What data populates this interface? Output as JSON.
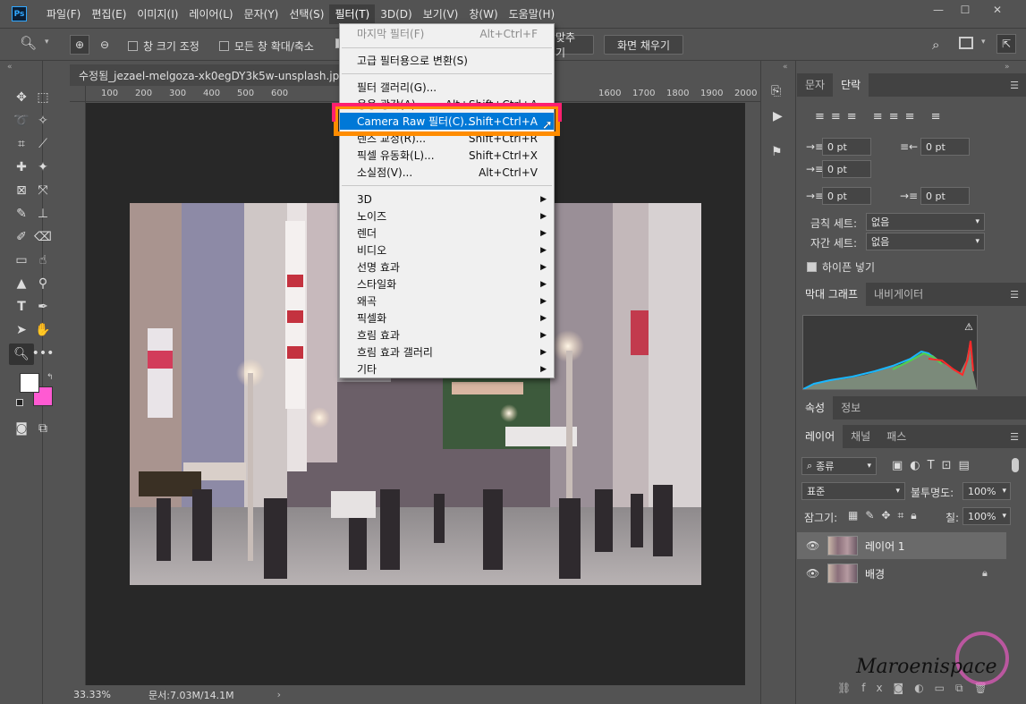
{
  "menubar": {
    "items": [
      "파일(F)",
      "편집(E)",
      "이미지(I)",
      "레이어(L)",
      "문자(Y)",
      "선택(S)",
      "필터(T)",
      "3D(D)",
      "보기(V)",
      "창(W)",
      "도움말(H)"
    ],
    "active": "필터(T)",
    "logo": "Ps"
  },
  "options": {
    "resize_windows": "창 크기 조정",
    "zoom_all_windows": "모든 창 확대/축소",
    "fit_screen_partial": "맞추기",
    "fill_screen": "화면 채우기"
  },
  "document": {
    "tab_title": "수정됨_jezael-melgoza-xk0egDY3k5w-unsplash.jpg @",
    "ruler_ticks": [
      "100",
      "200",
      "300",
      "400",
      "500",
      "600",
      "1600",
      "1700",
      "1800",
      "1900",
      "2000"
    ],
    "zoom": "33.33%",
    "doc_size": "문서:7.03M/14.1M"
  },
  "filter_menu": {
    "items": [
      {
        "label": "마지막 필터(F)",
        "shortcut": "Alt+Ctrl+F",
        "disabled": true
      },
      {
        "label": "고급 필터용으로 변환(S)"
      },
      {
        "label": "필터 갤러리(G)..."
      },
      {
        "label": "응용 광각(A)...",
        "shortcut": "Alt+Shift+Ctrl+A"
      },
      {
        "label": "Camera Raw 필터(C)...",
        "shortcut": "Shift+Ctrl+A",
        "highlighted": true
      },
      {
        "label": "렌즈 교정(R)...",
        "shortcut": "Shift+Ctrl+R"
      },
      {
        "label": "픽셀 유동화(L)...",
        "shortcut": "Shift+Ctrl+X"
      },
      {
        "label": "소실점(V)...",
        "shortcut": "Alt+Ctrl+V"
      },
      {
        "label": "3D",
        "submenu": true
      },
      {
        "label": "노이즈",
        "submenu": true
      },
      {
        "label": "렌더",
        "submenu": true
      },
      {
        "label": "비디오",
        "submenu": true
      },
      {
        "label": "선명 효과",
        "submenu": true
      },
      {
        "label": "스타일화",
        "submenu": true
      },
      {
        "label": "왜곡",
        "submenu": true
      },
      {
        "label": "픽셀화",
        "submenu": true
      },
      {
        "label": "흐림 효과",
        "submenu": true
      },
      {
        "label": "흐림 효과 갤러리",
        "submenu": true
      },
      {
        "label": "기타",
        "submenu": true
      }
    ]
  },
  "paragraph_panel": {
    "tabs": [
      "문자",
      "단락"
    ],
    "active_tab": "단락",
    "indent_left": "0 pt",
    "indent_right": "0 pt",
    "indent_first": "0 pt",
    "space_before": "0 pt",
    "space_after": "0 pt",
    "kinsoku_label": "금칙 세트:",
    "kinsoku_value": "없음",
    "mojikumi_label": "자간 세트:",
    "mojikumi_value": "없음",
    "hyphenate_label": "하이픈 넣기"
  },
  "histogram_panel": {
    "tabs": [
      "막대 그래프",
      "내비게이터"
    ],
    "active_tab": "막대 그래프"
  },
  "properties_panel": {
    "tabs": [
      "속성",
      "정보"
    ],
    "active_tab": "속성"
  },
  "layers_panel": {
    "tabs": [
      "레이어",
      "채널",
      "패스"
    ],
    "active_tab": "레이어",
    "filter_kind": "종류",
    "blend_mode": "표준",
    "opacity_label": "불투명도:",
    "opacity_value": "100%",
    "lock_label": "잠그기:",
    "fill_label": "칠:",
    "fill_value": "100%",
    "layers": [
      {
        "name": "레이어 1",
        "selected": true
      },
      {
        "name": "배경",
        "locked": true
      }
    ]
  },
  "watermark": "Maroenispace",
  "colors": {
    "highlight": "#0078d7",
    "callout_pink": "#ff1f6f",
    "callout_orange": "#ff8c00",
    "background_swatch": "#ff5ad2"
  }
}
